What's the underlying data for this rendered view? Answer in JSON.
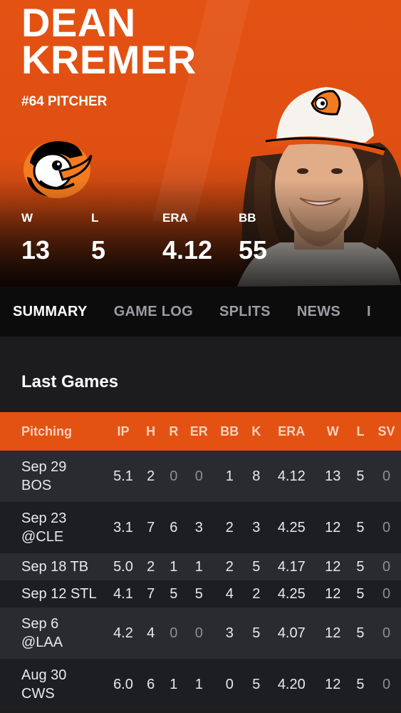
{
  "player": {
    "first_name": "DEAN",
    "last_name": "KREMER",
    "subtitle": "#64 PITCHER"
  },
  "hero_stats": [
    {
      "label": "W",
      "value": "13"
    },
    {
      "label": "L",
      "value": "5"
    },
    {
      "label": "ERA",
      "value": "4.12"
    },
    {
      "label": "BB",
      "value": "55"
    }
  ],
  "tabs": [
    "SUMMARY",
    "GAME LOG",
    "SPLITS",
    "NEWS",
    "I"
  ],
  "last_games": {
    "title": "Last Games",
    "columns": [
      "Pitching",
      "IP",
      "H",
      "R",
      "ER",
      "BB",
      "K",
      "ERA",
      "W",
      "L",
      "SV"
    ],
    "rows": [
      {
        "date": "Sep 29",
        "opp": "BOS",
        "cells": [
          "5.1",
          "2",
          "0",
          "0",
          "1",
          "8",
          "4.12",
          "13",
          "5",
          "0"
        ]
      },
      {
        "date": "Sep 23",
        "opp": "@CLE",
        "cells": [
          "3.1",
          "7",
          "6",
          "3",
          "2",
          "3",
          "4.25",
          "12",
          "5",
          "0"
        ]
      },
      {
        "date": "Sep 18 TB",
        "opp": "",
        "cells": [
          "5.0",
          "2",
          "1",
          "1",
          "2",
          "5",
          "4.17",
          "12",
          "5",
          "0"
        ]
      },
      {
        "date": "Sep 12 STL",
        "opp": "",
        "cells": [
          "4.1",
          "7",
          "5",
          "5",
          "4",
          "2",
          "4.25",
          "12",
          "5",
          "0"
        ]
      },
      {
        "date": "Sep 6",
        "opp": "@LAA",
        "cells": [
          "4.2",
          "4",
          "0",
          "0",
          "3",
          "5",
          "4.07",
          "12",
          "5",
          "0"
        ]
      },
      {
        "date": "Aug 30",
        "opp": "CWS",
        "cells": [
          "6.0",
          "6",
          "1",
          "1",
          "0",
          "5",
          "4.20",
          "12",
          "5",
          "0"
        ]
      }
    ]
  },
  "colors": {
    "accent": "#e35213",
    "tab_bg": "#0c0c0d",
    "row_odd": "#2a2b30",
    "row_even": "#1d1e22"
  }
}
